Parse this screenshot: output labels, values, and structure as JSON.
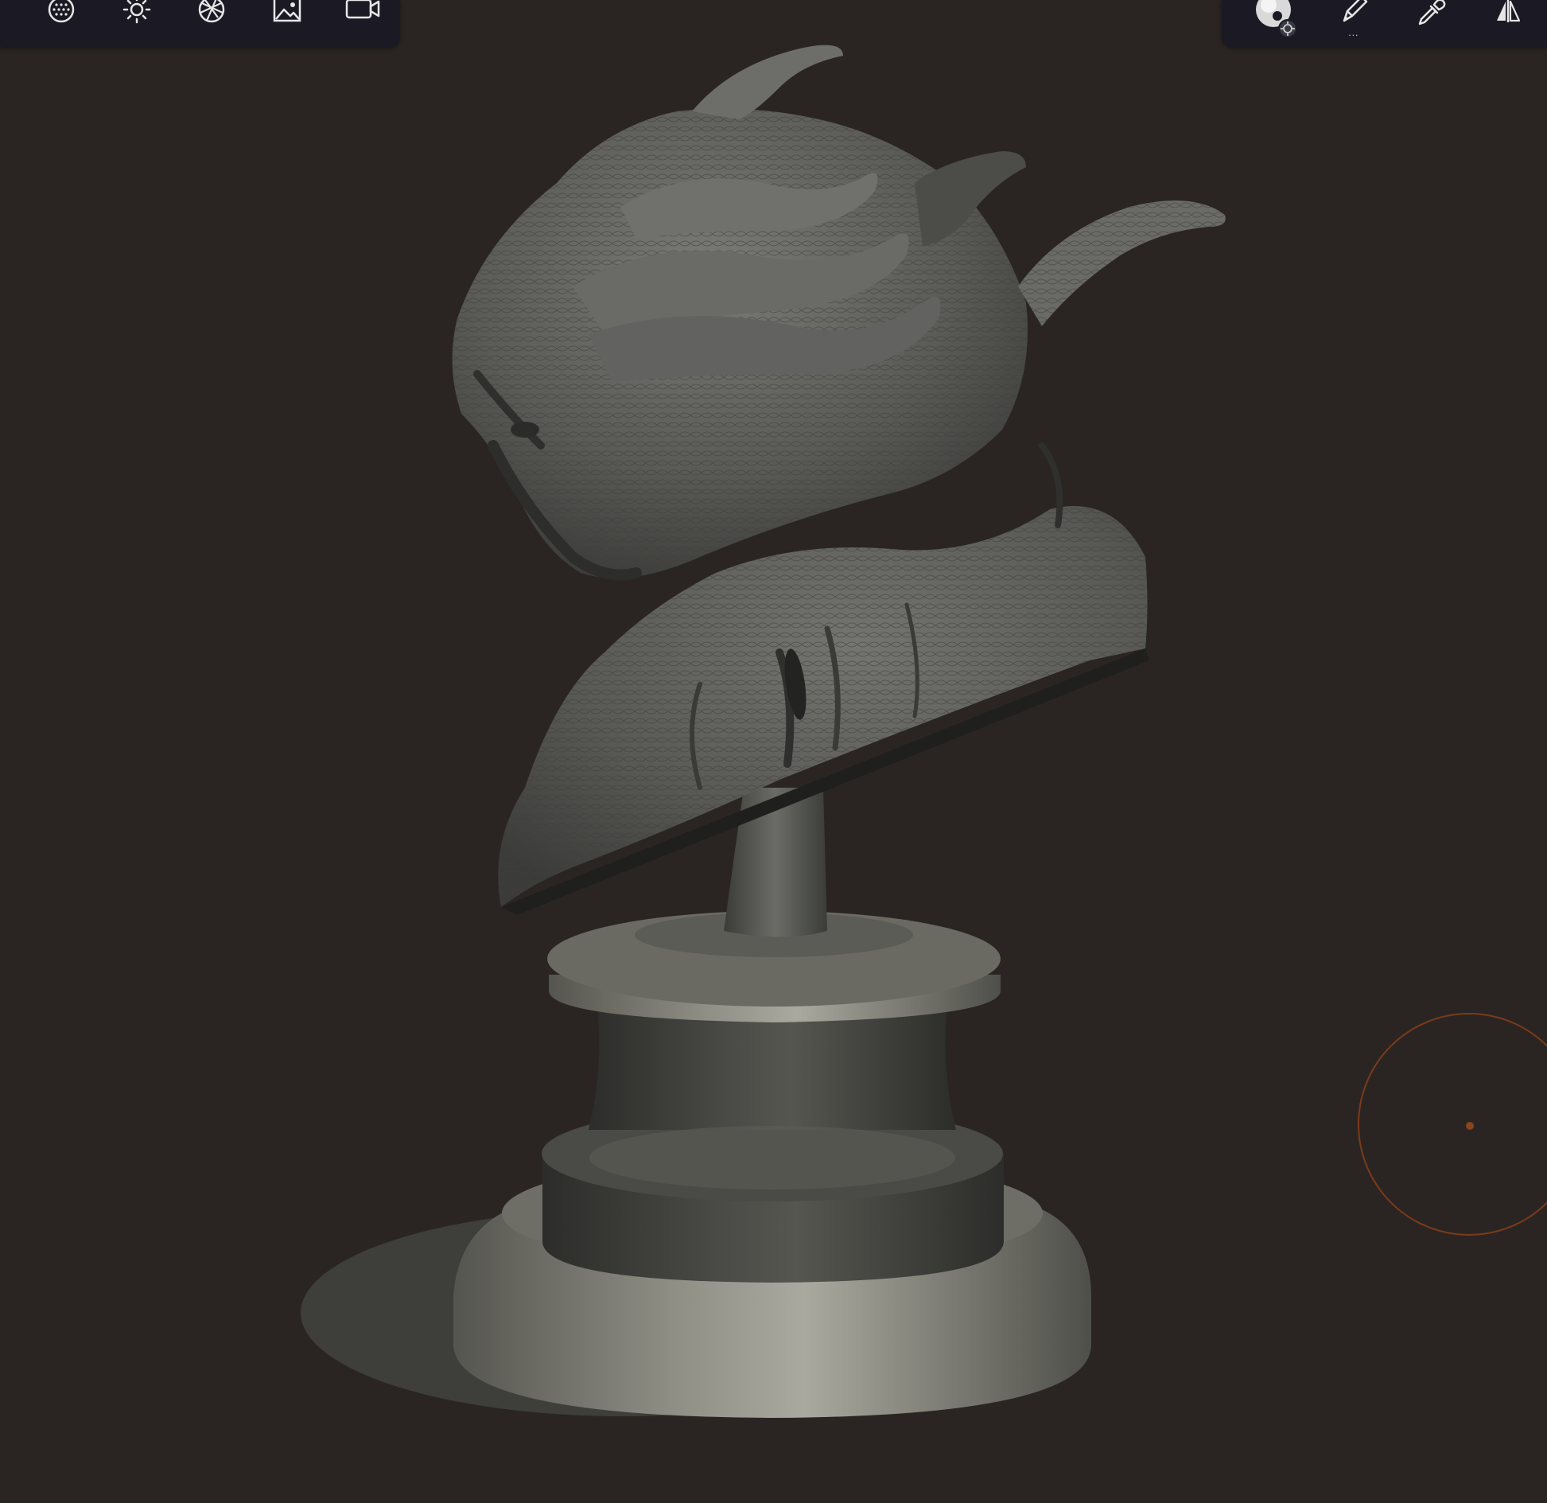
{
  "app": {
    "accent_color": "#8a4420",
    "background_color": "#2a2523",
    "toolbar_color": "#1b1a24"
  },
  "toolbar_left": {
    "tools": [
      {
        "icon": "matcap-sphere-icon",
        "name": "material"
      },
      {
        "icon": "sun-icon",
        "name": "lighting"
      },
      {
        "icon": "aperture-icon",
        "name": "post-processing"
      },
      {
        "icon": "image-icon",
        "name": "background"
      },
      {
        "icon": "video-camera-icon",
        "name": "camera"
      }
    ]
  },
  "toolbar_right": {
    "tools": [
      {
        "icon": "material-ball-icon",
        "name": "material-picker"
      },
      {
        "icon": "pen-icon",
        "name": "brush",
        "badge": "..."
      },
      {
        "icon": "eyedropper-icon",
        "name": "color-picker"
      },
      {
        "icon": "symmetry-icon",
        "name": "symmetry"
      }
    ]
  },
  "brush": {
    "cursor_color": "#7c3a1a"
  }
}
